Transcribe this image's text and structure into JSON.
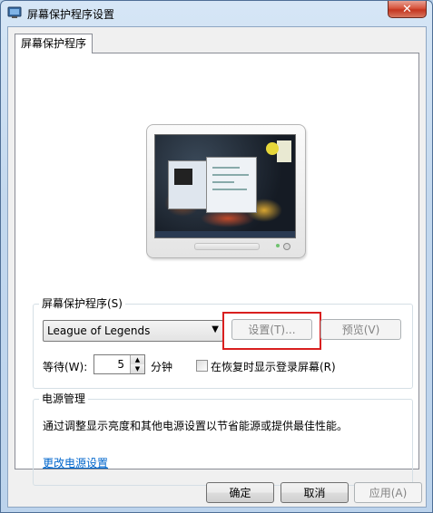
{
  "window": {
    "title": "屏幕保护程序设置",
    "close_label": "✕"
  },
  "tab": {
    "label": "屏幕保护程序"
  },
  "screensaver": {
    "group_label": "屏幕保护程序(S)",
    "selected": "League of Legends",
    "settings_label": "设置(T)...",
    "preview_label": "预览(V)",
    "wait_label": "等待(W):",
    "wait_value": "5",
    "wait_unit": "分钟",
    "resume_label": "在恢复时显示登录屏幕(R)"
  },
  "power": {
    "group_label": "电源管理",
    "description": "通过调整显示亮度和其他电源设置以节省能源或提供最佳性能。",
    "link_label": "更改电源设置"
  },
  "footer": {
    "ok_label": "确定",
    "cancel_label": "取消",
    "apply_label": "应用(A)"
  }
}
